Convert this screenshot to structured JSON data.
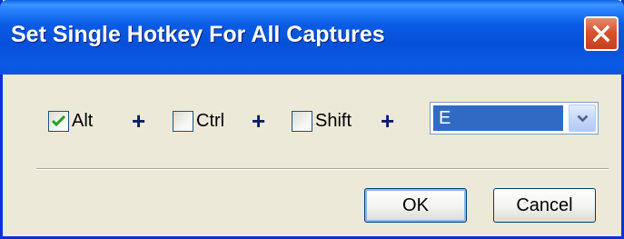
{
  "window": {
    "title": "Set Single Hotkey For All Captures",
    "close_icon": "close-icon"
  },
  "modifiers": [
    {
      "label": "Alt",
      "checked": true
    },
    {
      "label": "Ctrl",
      "checked": false
    },
    {
      "label": "Shift",
      "checked": false
    }
  ],
  "plus_symbol": "+",
  "key_select": {
    "selected": "E",
    "arrow_icon": "chevron-down-icon"
  },
  "buttons": {
    "ok_label": "OK",
    "cancel_label": "Cancel"
  },
  "colors": {
    "title_bar": "#0a5ce6",
    "dialog_background": "#ece9d8",
    "close_button": "#d8532b",
    "selection": "#316ac5",
    "checkmark": "#21a121",
    "plus": "#0b1a6e"
  }
}
